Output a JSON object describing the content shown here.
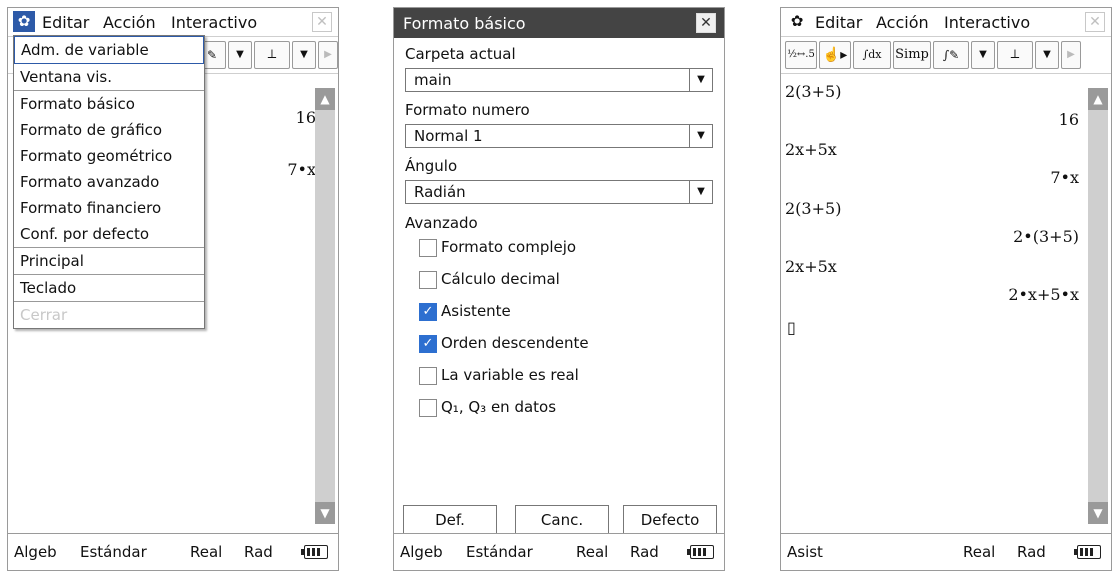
{
  "screen1": {
    "menubar": {
      "gear": "✿",
      "editar": "Editar",
      "accion": "Acción",
      "interactivo": "Interactivo",
      "close": "✕"
    },
    "menu": [
      "Adm. de variable",
      "Ventana vis.",
      "Formato básico",
      "Formato de gráfico",
      "Formato geométrico",
      "Formato avanzado",
      "Formato financiero",
      "Conf. por defecto",
      "Principal",
      "Teclado",
      "Cerrar"
    ],
    "results": [
      "16",
      "7•x"
    ],
    "status": {
      "mode": "Algeb",
      "format": "Estándar",
      "real": "Real",
      "angle": "Rad"
    }
  },
  "screen2": {
    "title": "Formato básico",
    "close": "✕",
    "carpeta_label": "Carpeta actual",
    "carpeta_value": "main",
    "formato_label": "Formato numero",
    "formato_value": "Normal 1",
    "angulo_label": "Ángulo",
    "angulo_value": "Radián",
    "avanzado_label": "Avanzado",
    "options": [
      {
        "label": "Formato complejo",
        "checked": false
      },
      {
        "label": "Cálculo decimal",
        "checked": false
      },
      {
        "label": "Asistente",
        "checked": true
      },
      {
        "label": "Orden descendente",
        "checked": true
      },
      {
        "label": "La variable es real",
        "checked": false
      },
      {
        "label": "Q₁, Q₃ en datos",
        "checked": false
      }
    ],
    "buttons": {
      "def": "Def.",
      "canc": "Canc.",
      "defecto": "Defecto"
    },
    "status": {
      "mode": "Algeb",
      "format": "Estándar",
      "real": "Real",
      "angle": "Rad"
    }
  },
  "screen3": {
    "menubar": {
      "gear": "✿",
      "editar": "Editar",
      "accion": "Acción",
      "interactivo": "Interactivo",
      "close": "✕"
    },
    "toolbar": {
      "simp": "Simp"
    },
    "lines": [
      {
        "input": "2(3+5)",
        "output": "16"
      },
      {
        "input": "2x+5x",
        "output": "7•x"
      },
      {
        "input": "2(3+5)",
        "output": "2•(3+5)"
      },
      {
        "input": "2x+5x",
        "output": "2•x+5•x"
      }
    ],
    "cursor": "▯",
    "status": {
      "mode": "Asist",
      "real": "Real",
      "angle": "Rad"
    }
  }
}
